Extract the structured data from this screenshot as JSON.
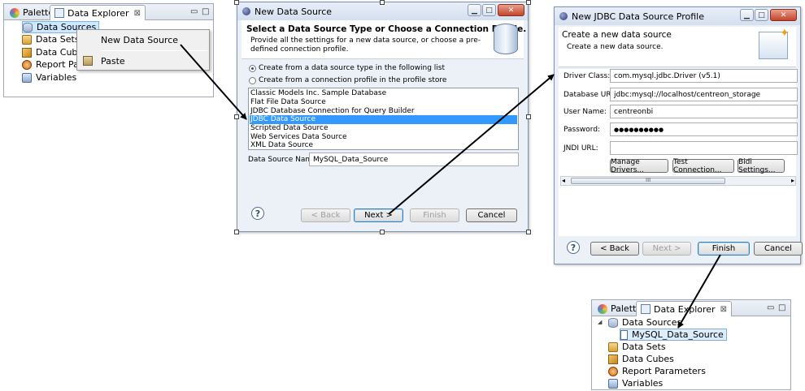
{
  "explorer_panel_1": {
    "tabs": [
      "Palette",
      "Data Explorer"
    ],
    "tree": [
      "Data Sources",
      "Data Sets",
      "Data Cubes",
      "Report Para",
      "Variables"
    ]
  },
  "context_menu": {
    "items": [
      "New Data Source",
      "Paste"
    ]
  },
  "new_data_source_dialog": {
    "window_title": "New Data Source",
    "heading": "Select a Data Source Type or Choose a Connection Profile.",
    "description": "Provide all the settings for a new data source, or choose a pre-defined connection profile.",
    "options": [
      "Create from a data source type in the following list",
      "Create from a connection profile in the profile store"
    ],
    "selected_option_index": 0,
    "source_types": [
      "Classic Models Inc. Sample Database",
      "Flat File Data Source",
      "JDBC Database Connection for Query Builder",
      "JDBC Data Source",
      "Scripted Data Source",
      "Web Services Data Source",
      "XML Data Source"
    ],
    "selected_source_index": 3,
    "name_label": "Data Source Name:",
    "name_value": "MySQL_Data_Source",
    "buttons": {
      "back": "< Back",
      "next": "Next >",
      "finish": "Finish",
      "cancel": "Cancel"
    }
  },
  "jdbc_dialog": {
    "window_title": "New JDBC Data Source Profile",
    "heading": "Create a new data source",
    "description": "Create a new data source.",
    "fields": [
      {
        "label": "Driver Class:",
        "value": "com.mysql.jdbc.Driver (v5.1)"
      },
      {
        "label": "Database URL:",
        "value": "jdbc:mysql://localhost/centreon_storage"
      },
      {
        "label": "User Name:",
        "value": "centreonbi"
      },
      {
        "label": "Password:",
        "value": "●●●●●●●●●●"
      },
      {
        "label": "JNDI URL:",
        "value": ""
      }
    ],
    "action_buttons": [
      "Manage Drivers...",
      "Test Connection...",
      "Bidi Settings..."
    ],
    "scroll_grip": "III",
    "buttons": {
      "back": "< Back",
      "next": "Next >",
      "finish": "Finish",
      "cancel": "Cancel"
    }
  },
  "explorer_panel_2": {
    "tabs": [
      "Palette",
      "Data Explorer"
    ],
    "tree": [
      "Data Sources",
      "MySQL_Data_Source",
      "Data Sets",
      "Data Cubes",
      "Report Parameters",
      "Variables"
    ]
  },
  "glyphs": {
    "close": "⊠",
    "minimize": "▭",
    "maximize": "□",
    "help": "?",
    "expand": "◢"
  }
}
